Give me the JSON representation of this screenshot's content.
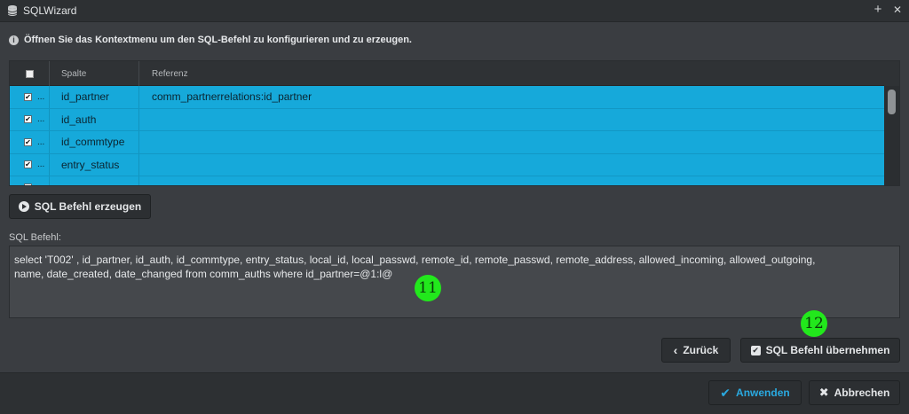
{
  "window": {
    "title": "SQLWizard",
    "add_icon": "+",
    "close_icon": "✕"
  },
  "info": {
    "text": "Öffnen Sie das Kontextmenu um den SQL-Befehl zu konfigurieren und zu erzeugen."
  },
  "table": {
    "headers": {
      "spalte": "Spalte",
      "referenz": "Referenz"
    },
    "rows": [
      {
        "checked": true,
        "dots": "...",
        "spalte": "id_partner",
        "referenz": "comm_partnerrelations:id_partner"
      },
      {
        "checked": true,
        "dots": "...",
        "spalte": "id_auth",
        "referenz": ""
      },
      {
        "checked": true,
        "dots": "...",
        "spalte": "id_commtype",
        "referenz": ""
      },
      {
        "checked": true,
        "dots": "...",
        "spalte": "entry_status",
        "referenz": ""
      }
    ]
  },
  "buttons": {
    "generate": "SQL Befehl erzeugen",
    "back": "Zurück",
    "apply_sql": "SQL Befehl übernehmen",
    "apply": "Anwenden",
    "cancel": "Abbrechen"
  },
  "sql": {
    "label": "SQL Befehl:",
    "text": "select 'T002' , id_partner, id_auth, id_commtype, entry_status, local_id, local_passwd, remote_id, remote_passwd, remote_address, allowed_incoming, allowed_outgoing,\nname, date_created, date_changed from comm_auths where id_partner=@1:l@"
  },
  "markers": {
    "m11": "11",
    "m12": "12"
  },
  "colors": {
    "row_selected": "#16a9da",
    "marker": "#22e81c",
    "accent": "#2aa9e0"
  }
}
